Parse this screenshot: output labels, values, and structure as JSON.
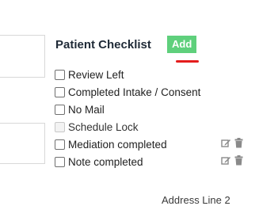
{
  "checklist": {
    "title": "Patient Checklist",
    "add_label": "Add",
    "items": [
      {
        "label": "Review Left",
        "checked": false,
        "disabled": false,
        "actions": false
      },
      {
        "label": "Completed Intake / Consent",
        "checked": false,
        "disabled": false,
        "actions": false
      },
      {
        "label": "No Mail",
        "checked": false,
        "disabled": false,
        "actions": false
      },
      {
        "label": "Schedule Lock",
        "checked": false,
        "disabled": true,
        "actions": false
      },
      {
        "label": "Mediation completed",
        "checked": false,
        "disabled": false,
        "actions": true
      },
      {
        "label": "Note completed",
        "checked": false,
        "disabled": false,
        "actions": true
      }
    ]
  },
  "address": {
    "line2_label": "Address Line 2"
  },
  "colors": {
    "add_button": "#5fd07c",
    "underline": "#e41d1d",
    "icon": "#8a8a8a"
  },
  "icons": {
    "edit": "edit-icon",
    "delete": "trash-icon"
  }
}
